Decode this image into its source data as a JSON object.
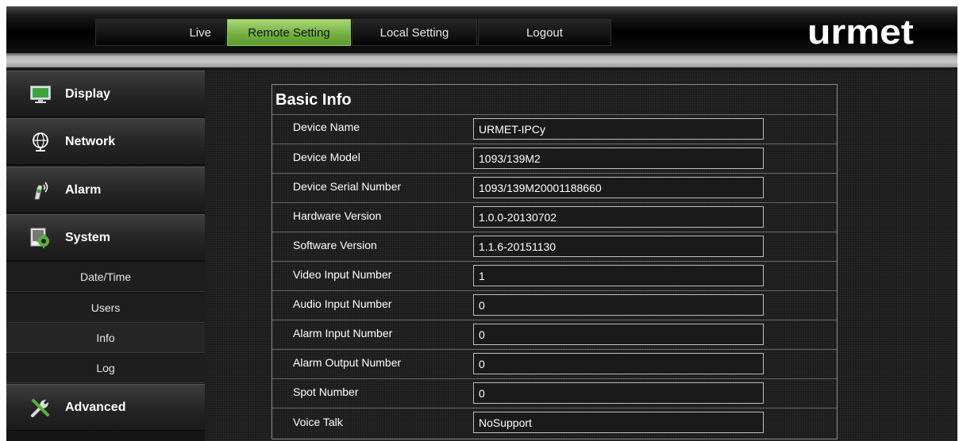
{
  "nav": {
    "tabs": [
      {
        "label": "Live"
      },
      {
        "label": "Remote Setting",
        "active": true
      },
      {
        "label": "Local Setting"
      },
      {
        "label": "Logout"
      }
    ],
    "brand": "urmet"
  },
  "sidebar": {
    "categories": [
      {
        "label": "Display",
        "icon": "monitor-icon"
      },
      {
        "label": "Network",
        "icon": "globe-icon"
      },
      {
        "label": "Alarm",
        "icon": "alarm-icon"
      },
      {
        "label": "System",
        "icon": "gear-icon",
        "expanded": true
      },
      {
        "label": "Advanced",
        "icon": "tools-icon"
      }
    ],
    "system_items": [
      {
        "label": "Date/Time"
      },
      {
        "label": "Users"
      },
      {
        "label": "Info",
        "active": true
      },
      {
        "label": "Log"
      }
    ]
  },
  "panel": {
    "title": "Basic Info",
    "rows": [
      {
        "label": "Device Name",
        "value": "URMET-IPCy"
      },
      {
        "label": "Device Model",
        "value": "1093/139M2"
      },
      {
        "label": "Device Serial Number",
        "value": "1093/139M20001188660"
      },
      {
        "label": "Hardware Version",
        "value": "1.0.0-20130702"
      },
      {
        "label": "Software Version",
        "value": "1.1.6-20151130"
      },
      {
        "label": "Video Input Number",
        "value": "1"
      },
      {
        "label": "Audio Input Number",
        "value": "0"
      },
      {
        "label": "Alarm Input Number",
        "value": "0"
      },
      {
        "label": "Alarm Output Number",
        "value": "0"
      },
      {
        "label": "Spot Number",
        "value": "0"
      },
      {
        "label": "Voice Talk",
        "value": "NoSupport"
      }
    ]
  },
  "colors": {
    "accent": "#7bbb45",
    "background": "#1b1b1b",
    "field_border": "#bdbdbd"
  }
}
